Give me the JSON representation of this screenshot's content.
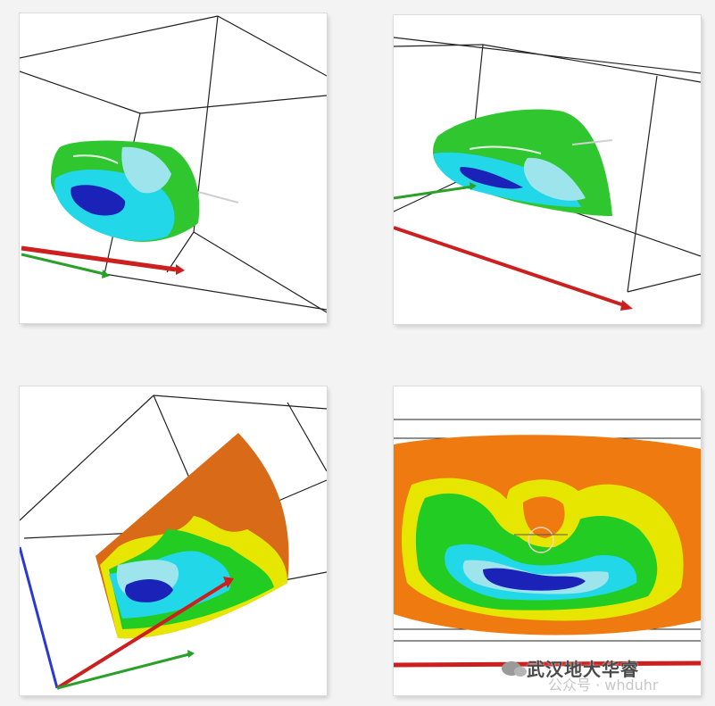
{
  "watermark": {
    "text": "武汉地大华睿",
    "handle": "公众号 · whduhr",
    "icon": "wechat-icon"
  },
  "colors": {
    "axis_red": "#cc2020",
    "axis_green": "#2aa02a",
    "axis_blue": "#2a3ad0",
    "deep_blue": "#1a22b8",
    "cyan": "#22d8e8",
    "light_cyan": "#9de4ec",
    "green": "#22cc22",
    "yellow": "#e6e600",
    "orange": "#ee7a10",
    "dark_orange": "#d86a18"
  }
}
